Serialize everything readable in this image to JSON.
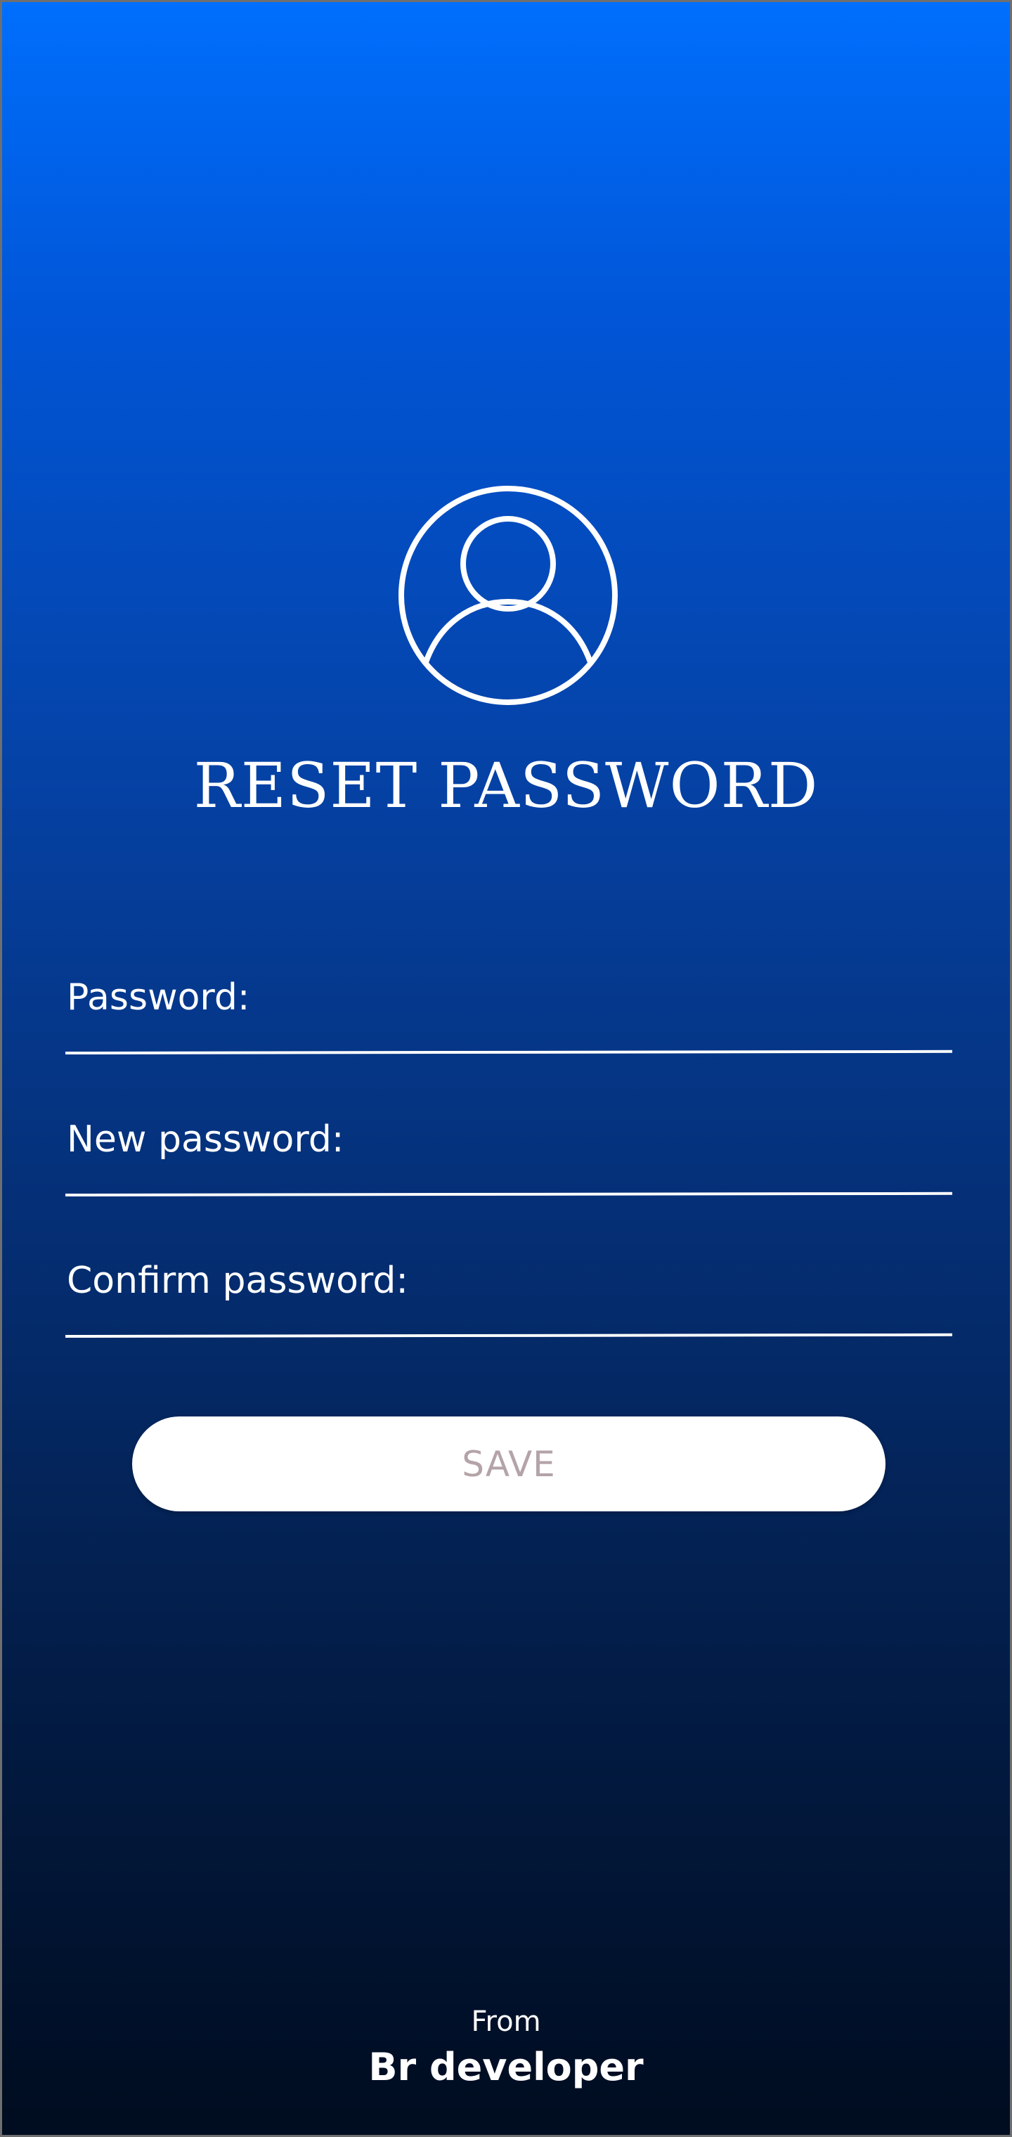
{
  "header": {
    "icon": "user-circle-icon",
    "title": "RESET PASSWORD"
  },
  "form": {
    "password_label": "Password:",
    "new_password_label": "New password:",
    "confirm_password_label": "Confirm password:",
    "save_label": "SAVE"
  },
  "footer": {
    "from": "From",
    "developer": "Br developer"
  },
  "colors": {
    "gradient_top": "#006ffd",
    "gradient_bottom": "#000c1f",
    "text": "#ffffff",
    "button_bg": "#ffffff",
    "button_text": "#b4a4a7"
  }
}
